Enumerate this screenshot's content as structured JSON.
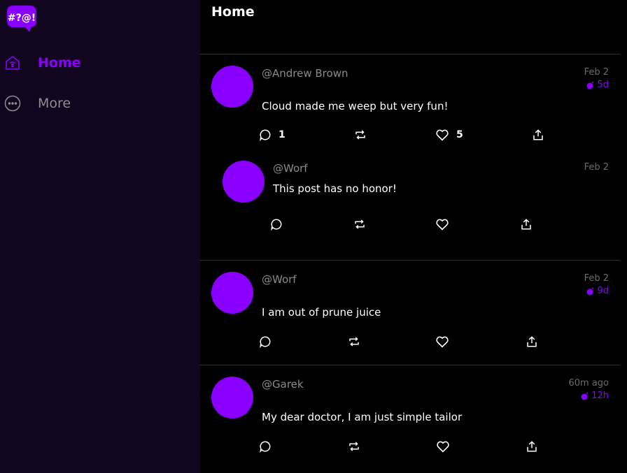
{
  "app": {
    "logo_text": "#?@!",
    "brand_color": "#8a00ff"
  },
  "sidebar": {
    "items": [
      {
        "label": "Home",
        "icon": "home-icon",
        "active": true
      },
      {
        "label": "More",
        "icon": "more-icon",
        "active": false
      }
    ]
  },
  "header": {
    "title": "Home"
  },
  "posts": [
    {
      "handle": "@Andrew Brown",
      "date": "Feb 2",
      "ttl": "5d",
      "content": "Cloud made me weep but very fun!",
      "reply_count": "1",
      "like_count": "5"
    },
    {
      "handle": "@Worf",
      "date": "Feb 2",
      "content": "This post has no honor!",
      "reply_count": "",
      "like_count": ""
    },
    {
      "handle": "@Worf",
      "date": "Feb 2",
      "ttl": "9d",
      "content": "I am out of prune juice",
      "reply_count": "",
      "like_count": ""
    },
    {
      "handle": "@Garek",
      "date": "60m ago",
      "ttl": "12h",
      "content": "My dear doctor, I am just simple tailor",
      "reply_count": "",
      "like_count": ""
    }
  ]
}
